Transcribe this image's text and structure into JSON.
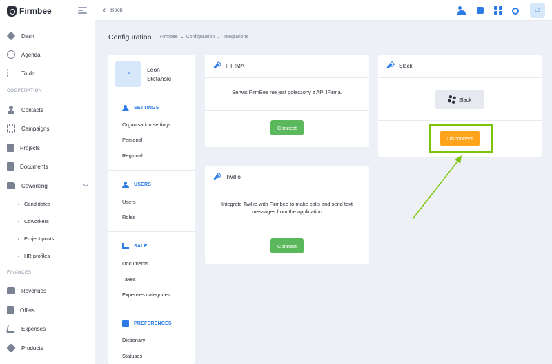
{
  "sidebar": {
    "brand": "Firmbee",
    "items": [
      {
        "label": "Dash",
        "icon": "dashboard-icon"
      },
      {
        "label": "Agenda",
        "icon": "clock-icon"
      },
      {
        "label": "To do",
        "icon": "checklist-icon"
      }
    ],
    "sections": {
      "cooperation": "COOPERATION",
      "finances": "FINANCES"
    },
    "cooperation_items": [
      {
        "label": "Contacts",
        "icon": "contacts-icon"
      },
      {
        "label": "Campaigns",
        "icon": "campaigns-icon"
      },
      {
        "label": "Projects",
        "icon": "projects-icon"
      },
      {
        "label": "Documents",
        "icon": "documents-icon"
      },
      {
        "label": "Coworking",
        "icon": "coworking-icon"
      }
    ],
    "coworking_sub": [
      "Candidates",
      "Coworkers",
      "Project posts",
      "HR profiles"
    ],
    "finance_items": [
      {
        "label": "Revenues",
        "icon": "wallet-icon"
      },
      {
        "label": "Offers",
        "icon": "offers-icon"
      },
      {
        "label": "Expenses",
        "icon": "cart-icon"
      },
      {
        "label": "Products",
        "icon": "box-icon"
      }
    ]
  },
  "topbar": {
    "back_label": "Back",
    "avatar_initials": "LS"
  },
  "page": {
    "title": "Configuration",
    "breadcrumb": [
      "Firmbee",
      "Configuration",
      "Integrations"
    ]
  },
  "settings_panel": {
    "avatar_initials": "LS",
    "user_name": "Leon Stefański",
    "groups": [
      {
        "title": "SETTINGS",
        "links": [
          "Organisation settings",
          "Personal",
          "Regional"
        ]
      },
      {
        "title": "USERS",
        "links": [
          "Users",
          "Roles"
        ]
      },
      {
        "title": "SALE",
        "links": [
          "Documents",
          "Taxes",
          "Expenses categories"
        ]
      },
      {
        "title": "PREFERENCES",
        "links": [
          "Dictionary",
          "Statuses"
        ]
      }
    ]
  },
  "integrations": {
    "ifirma": {
      "title": "IFIRMA",
      "description": "Serwis FirmBee nie jest połączony z API IFirma.",
      "button": "Connect"
    },
    "twillio": {
      "title": "Twillio",
      "description": "Integrate Twillio with Firmbee to make calls and send text messages from the application",
      "button": "Connect"
    },
    "slack": {
      "title": "Slack",
      "slack_button": "Slack",
      "disconnect_button": "Disconnect"
    }
  },
  "colors": {
    "accent": "#2c7be5",
    "connect": "#5cb85c",
    "disconnect": "#ffa41b",
    "highlight": "#7dc30a"
  }
}
